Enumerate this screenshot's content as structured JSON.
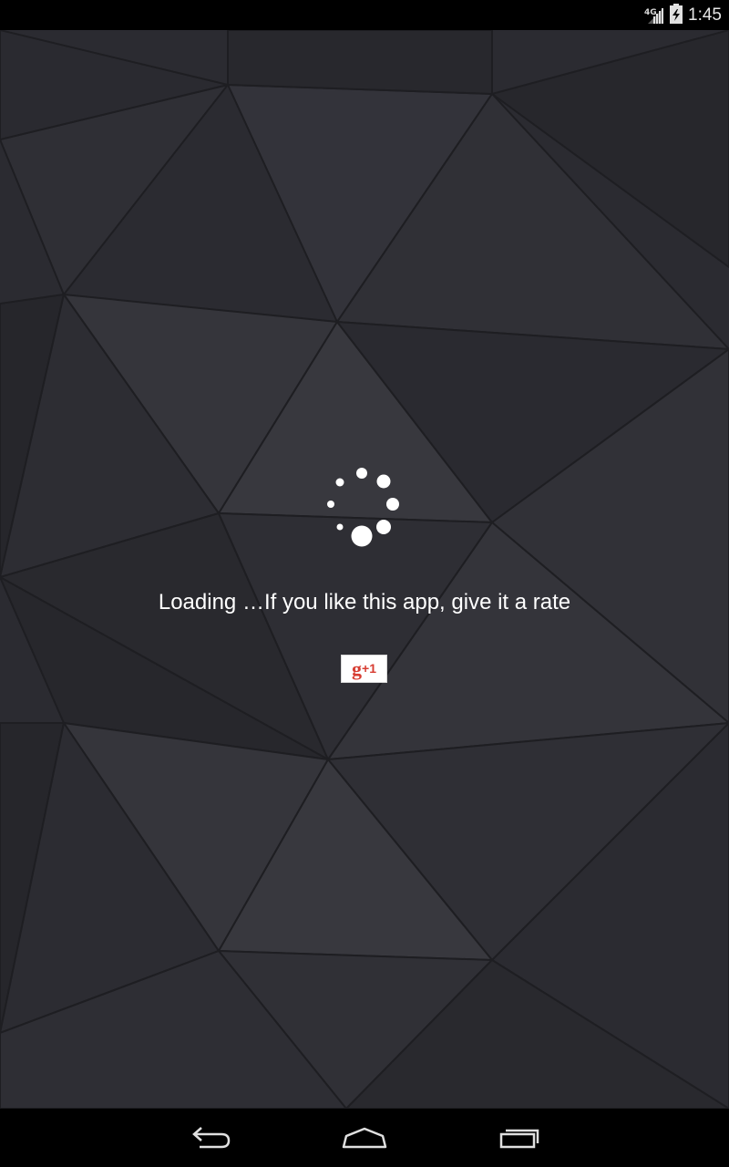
{
  "status_bar": {
    "network_label": "4G",
    "time": "1:45",
    "icons": [
      "signal-icon",
      "battery-icon"
    ]
  },
  "main": {
    "loading_message": "Loading …If you like this app, give it a rate",
    "spinner_icon": "loading-spinner-icon",
    "gplus_button": {
      "g_label": "g",
      "plus_label": "+1"
    }
  },
  "nav_bar": {
    "icons": [
      "back-icon",
      "home-icon",
      "recent-apps-icon"
    ]
  },
  "colors": {
    "wallpaper": "#2b2b31",
    "text": "#ffffff",
    "gplus_red": "#d73d32",
    "bars": "#000000"
  }
}
